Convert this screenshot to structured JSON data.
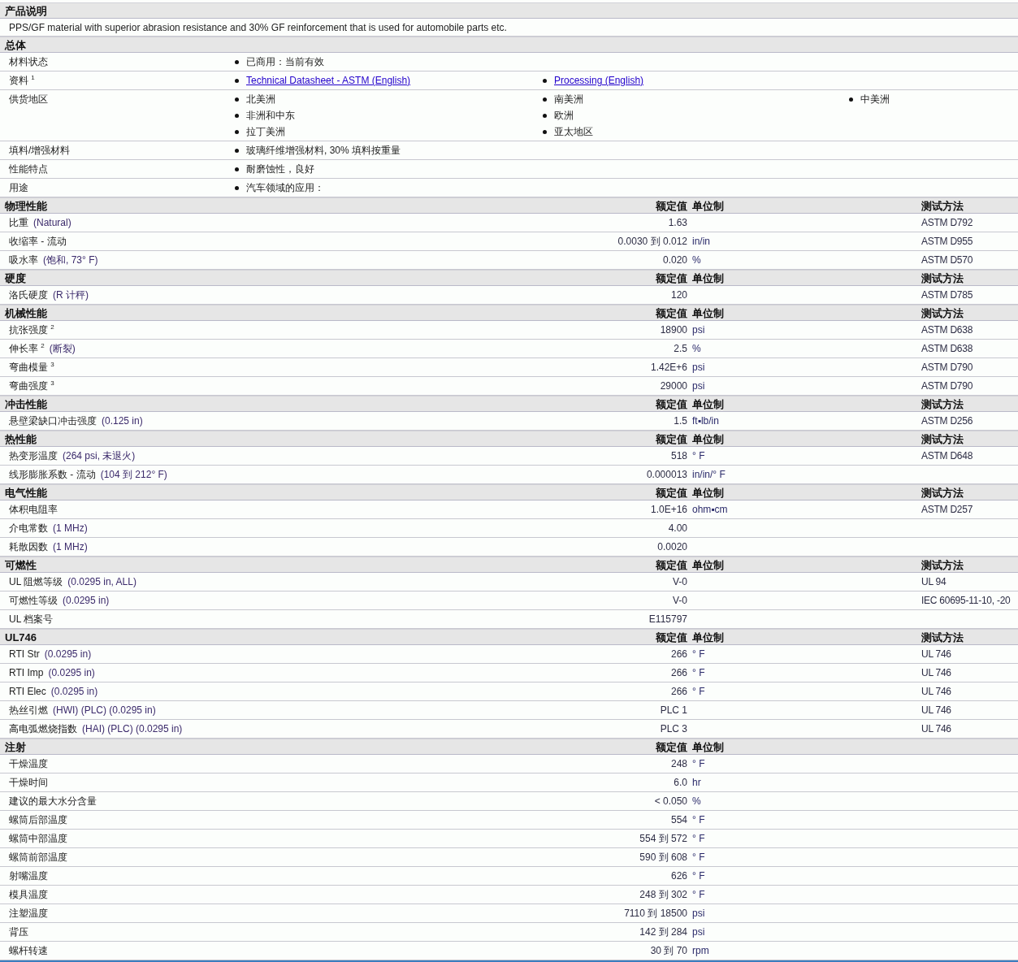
{
  "description_section": {
    "title": "产品说明",
    "text": "PPS/GF material with superior abrasion resistance and 30% GF reinforcement that is used for automobile parts etc."
  },
  "general_section": {
    "title": "总体",
    "rows": [
      {
        "label": "材料状态",
        "kind": "text",
        "columns": [
          [
            "已商用：当前有效"
          ]
        ]
      },
      {
        "label": "资料 $^{1}$",
        "kind": "link",
        "columns": [
          [
            "Technical Datasheet - ASTM (English)"
          ],
          [
            "Processing (English)"
          ]
        ]
      },
      {
        "label": "供货地区",
        "kind": "text",
        "columns": [
          [
            "北美洲",
            "非洲和中东",
            "拉丁美洲"
          ],
          [
            "南美洲",
            "欧洲",
            "亚太地区"
          ],
          [
            "中美洲"
          ]
        ]
      },
      {
        "label": "填料/增强材料",
        "kind": "text",
        "columns": [
          [
            "玻璃纤维增强材料, 30% 填料按重量"
          ]
        ]
      },
      {
        "label": "性能特点",
        "kind": "text",
        "columns": [
          [
            "耐磨蚀性，良好"
          ]
        ]
      },
      {
        "label": "用途",
        "kind": "text",
        "columns": [
          [
            "汽车领域的应用："
          ]
        ]
      }
    ]
  },
  "property_sections": [
    {
      "title": "物理性能",
      "value_heading": "额定值",
      "unit_heading": "单位制",
      "method_heading": "测试方法",
      "rows": [
        {
          "name": "比重",
          "condition": "(Natural)",
          "value": "1.63",
          "method": "ASTM D792"
        },
        {
          "name": "收缩率 - 流动",
          "value": "0.0030 到 0.012",
          "unit": "in/in",
          "method": "ASTM D955"
        },
        {
          "name": "吸水率",
          "condition": "(饱和, 73° F)",
          "value": "0.020",
          "unit": "%",
          "method": "ASTM D570"
        }
      ]
    },
    {
      "title": "硬度",
      "value_heading": "额定值",
      "unit_heading": "单位制",
      "method_heading": "测试方法",
      "rows": [
        {
          "name": "洛氏硬度",
          "condition": "(R 计秤)",
          "value": "120",
          "method": "ASTM D785"
        }
      ]
    },
    {
      "title": "机械性能",
      "value_heading": "额定值",
      "unit_heading": "单位制",
      "method_heading": "测试方法",
      "rows": [
        {
          "name": "抗张强度 $^{2}$",
          "value": "18900",
          "unit": "psi",
          "method": "ASTM D638"
        },
        {
          "name": "伸长率 $^{2}$",
          "condition": "(断裂)",
          "value": "2.5",
          "unit": "%",
          "method": "ASTM D638"
        },
        {
          "name": "弯曲模量 $^{3}$",
          "value": "1.42E+6",
          "unit": "psi",
          "method": "ASTM D790"
        },
        {
          "name": "弯曲强度 $^{3}$",
          "value": "29000",
          "unit": "psi",
          "method": "ASTM D790"
        }
      ]
    },
    {
      "title": "冲击性能",
      "value_heading": "额定值",
      "unit_heading": "单位制",
      "method_heading": "测试方法",
      "rows": [
        {
          "name": "悬壁梁缺口冲击强度",
          "condition": "(0.125 in)",
          "value": "1.5",
          "unit": "ft▪lb/in",
          "method": "ASTM D256"
        }
      ]
    },
    {
      "title": "热性能",
      "value_heading": "额定值",
      "unit_heading": "单位制",
      "method_heading": "测试方法",
      "rows": [
        {
          "name": "热变形温度",
          "condition": "(264 psi, 未退火)",
          "value": "518",
          "unit": "° F",
          "method": "ASTM D648"
        },
        {
          "name": "线形膨胀系数 - 流动",
          "condition": "(104 到 212° F)",
          "value": "0.000013",
          "unit": "in/in/° F"
        }
      ]
    },
    {
      "title": "电气性能",
      "value_heading": "额定值",
      "unit_heading": "单位制",
      "method_heading": "测试方法",
      "rows": [
        {
          "name": "体积电阻率",
          "value": "1.0E+16",
          "unit": "ohm▪cm",
          "method": "ASTM D257"
        },
        {
          "name": "介电常数",
          "condition": "(1 MHz)",
          "value": "4.00"
        },
        {
          "name": "耗散因数",
          "condition": "(1 MHz)",
          "value": "0.0020"
        }
      ]
    },
    {
      "title": "可燃性",
      "value_heading": "额定值",
      "unit_heading": "单位制",
      "method_heading": "测试方法",
      "rows": [
        {
          "name": "UL 阻燃等级",
          "condition": "(0.0295 in, ALL)",
          "value": "V-0",
          "method": "UL 94"
        },
        {
          "name": "可燃性等级",
          "condition": "(0.0295 in)",
          "value": "V-0",
          "method": "IEC 60695-11-10, -20"
        },
        {
          "name": "UL 档案号",
          "value": "E115797"
        }
      ]
    },
    {
      "title": "UL746",
      "value_heading": "额定值",
      "unit_heading": "单位制",
      "method_heading": "测试方法",
      "rows": [
        {
          "name": "RTI Str",
          "condition": "(0.0295 in)",
          "value": "266",
          "unit": "° F",
          "method": "UL 746"
        },
        {
          "name": "RTI Imp",
          "condition": "(0.0295 in)",
          "value": "266",
          "unit": "° F",
          "method": "UL 746"
        },
        {
          "name": "RTI Elec",
          "condition": "(0.0295 in)",
          "value": "266",
          "unit": "° F",
          "method": "UL 746"
        },
        {
          "name": "热丝引燃",
          "condition": "(HWI) (PLC) (0.0295 in)",
          "value": "PLC 1",
          "method": "UL 746"
        },
        {
          "name": "高电弧燃烧指数",
          "condition": "(HAI) (PLC) (0.0295 in)",
          "value": "PLC 3",
          "method": "UL 746"
        }
      ]
    },
    {
      "title": "注射",
      "value_heading": "额定值",
      "unit_heading": "单位制",
      "rows": [
        {
          "name": "干燥温度",
          "value": "248",
          "unit": "° F"
        },
        {
          "name": "干燥时间",
          "value": "6.0",
          "unit": "hr"
        },
        {
          "name": "建议的最大水分含量",
          "value": "< 0.050",
          "unit": "%"
        },
        {
          "name": "螺筒后部温度",
          "value": "554",
          "unit": "° F"
        },
        {
          "name": "螺筒中部温度",
          "value": "554 到 572",
          "unit": "° F"
        },
        {
          "name": "螺筒前部温度",
          "value": "590 到 608",
          "unit": "° F"
        },
        {
          "name": "射嘴温度",
          "value": "626",
          "unit": "° F"
        },
        {
          "name": "模具温度",
          "value": "248 到 302",
          "unit": "° F"
        },
        {
          "name": "注塑温度",
          "value": "7110 到 18500",
          "unit": "psi"
        },
        {
          "name": "背压",
          "value": "142 到 284",
          "unit": "psi"
        },
        {
          "name": "螺杆转速",
          "value": "30 到 70",
          "unit": "rpm"
        }
      ]
    }
  ]
}
